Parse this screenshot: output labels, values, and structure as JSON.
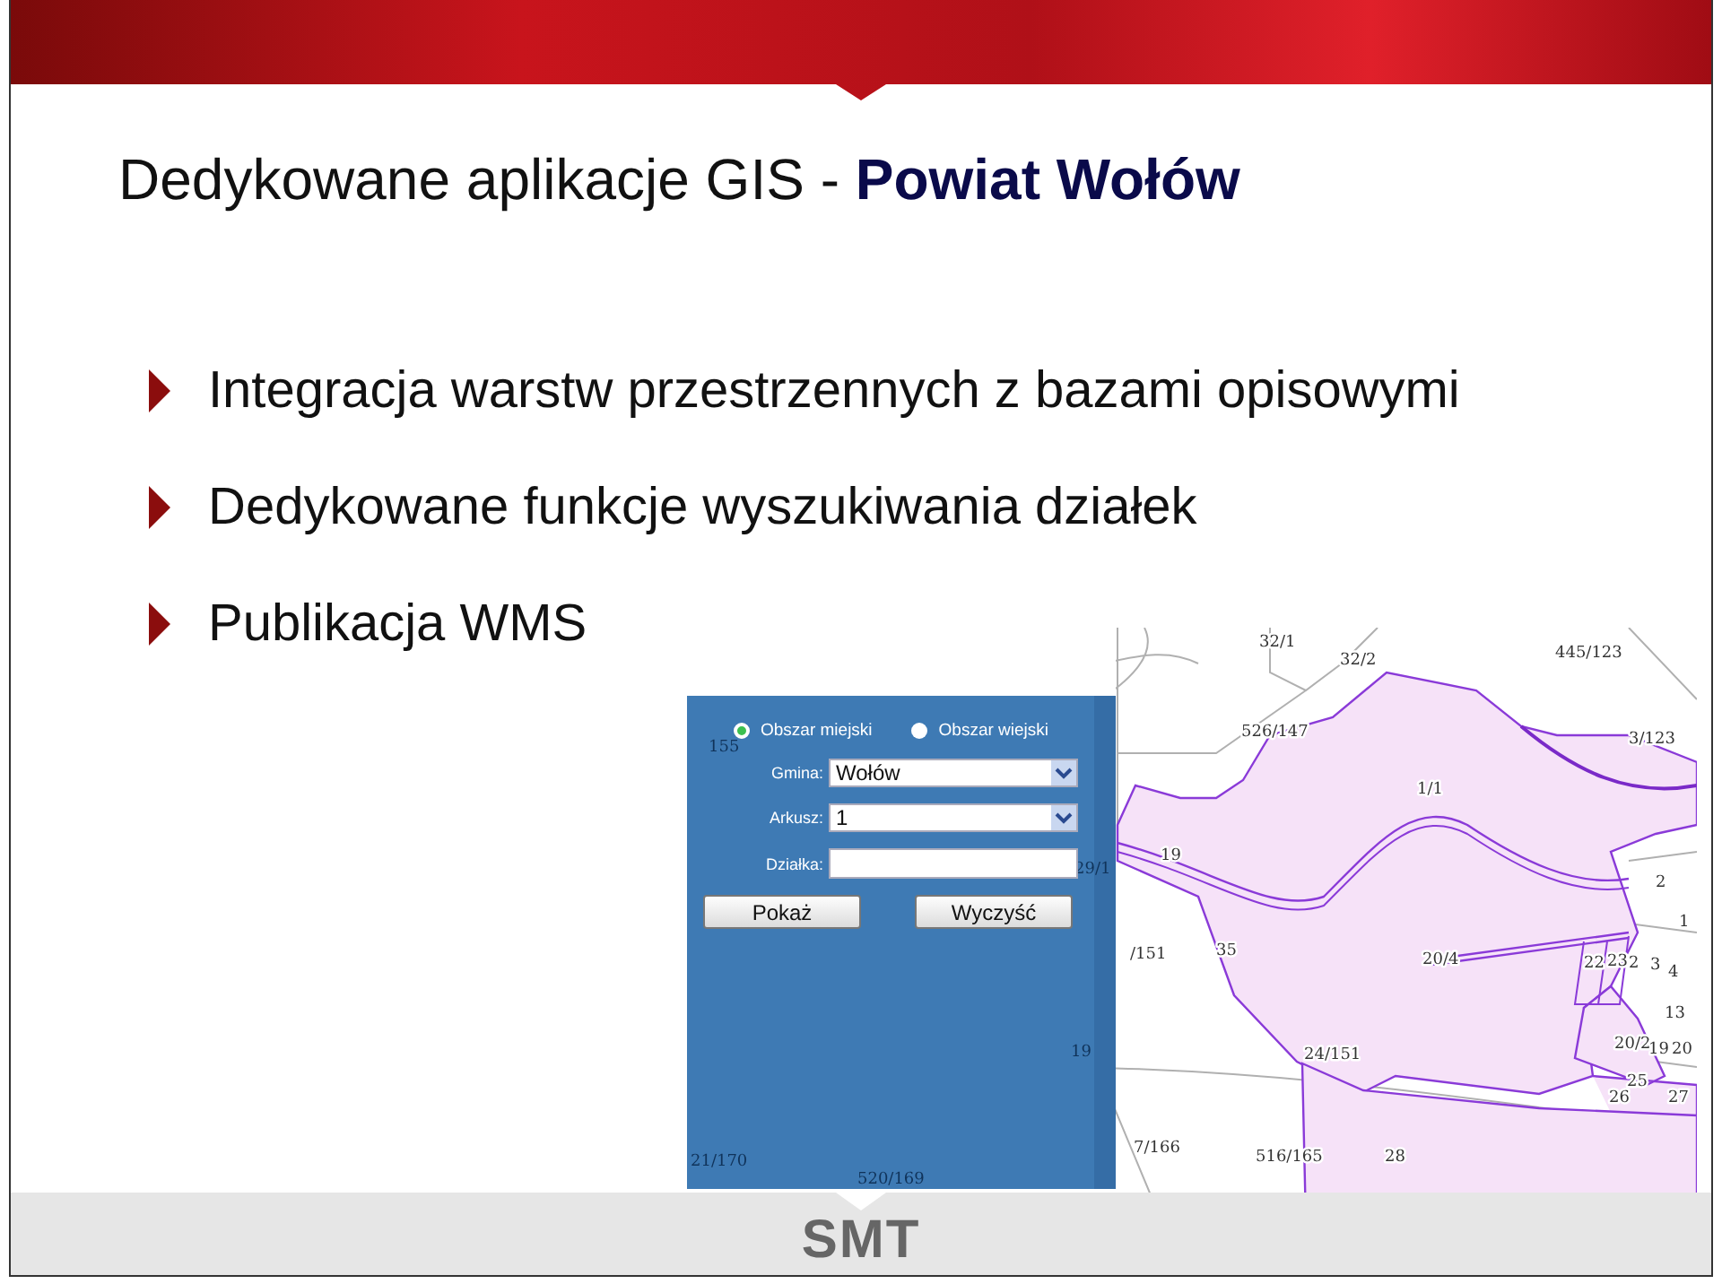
{
  "title": {
    "plain": "Dedykowane aplikacje GIS - ",
    "bold": "Powiat Wołów"
  },
  "bullets": [
    "Integracja warstw przestrzennych z bazami opisowymi",
    "Dedykowane funkcje wyszukiwania działek",
    "Publikacja WMS"
  ],
  "search_panel": {
    "radios": [
      {
        "label": "Obszar miejski",
        "selected": true
      },
      {
        "label": "Obszar wiejski",
        "selected": false
      }
    ],
    "fields": [
      {
        "kind": "select",
        "label": "Gmina:",
        "value": "Wołów"
      },
      {
        "kind": "select",
        "label": "Arkusz:",
        "value": "1"
      },
      {
        "kind": "text",
        "label": "Działka:"
      }
    ],
    "buttons": [
      "Pokaż",
      "Wyczyść"
    ],
    "background_labels": [
      "155",
      "21/170",
      "520/169",
      "29/1",
      "19"
    ]
  },
  "map": {
    "parcel_labels": [
      "32/1",
      "32/2",
      "445/123",
      "526/147",
      "3/123",
      "1/1",
      "19",
      "/151",
      "35",
      "20/4",
      "22",
      "23",
      "2",
      "3",
      "4",
      "1",
      "2",
      "13",
      "20/2",
      "19",
      "20",
      "25",
      "26",
      "27",
      "24/151",
      "7/166",
      "516/165",
      "28"
    ]
  },
  "footer": {
    "logo": "SMT"
  }
}
